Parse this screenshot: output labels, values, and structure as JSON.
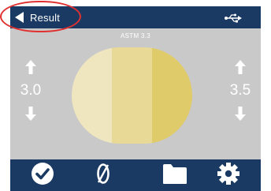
{
  "header": {
    "back_label": "Result",
    "back_icon": "back-triangle-icon",
    "status_icon": "usb-icon"
  },
  "scale_label": "ASTM 3.3",
  "left_value": "3.0",
  "right_value": "3.5",
  "color_segments": [
    "#efe6bf",
    "#e8da96",
    "#e0cb6a"
  ],
  "toolbar": {
    "icons": [
      "checkmark-icon",
      "zero-icon",
      "folder-icon",
      "gear-icon"
    ]
  },
  "colors": {
    "bar": "#1a3a63",
    "panel": "#c9c9c9",
    "annotation": "#e03030"
  }
}
